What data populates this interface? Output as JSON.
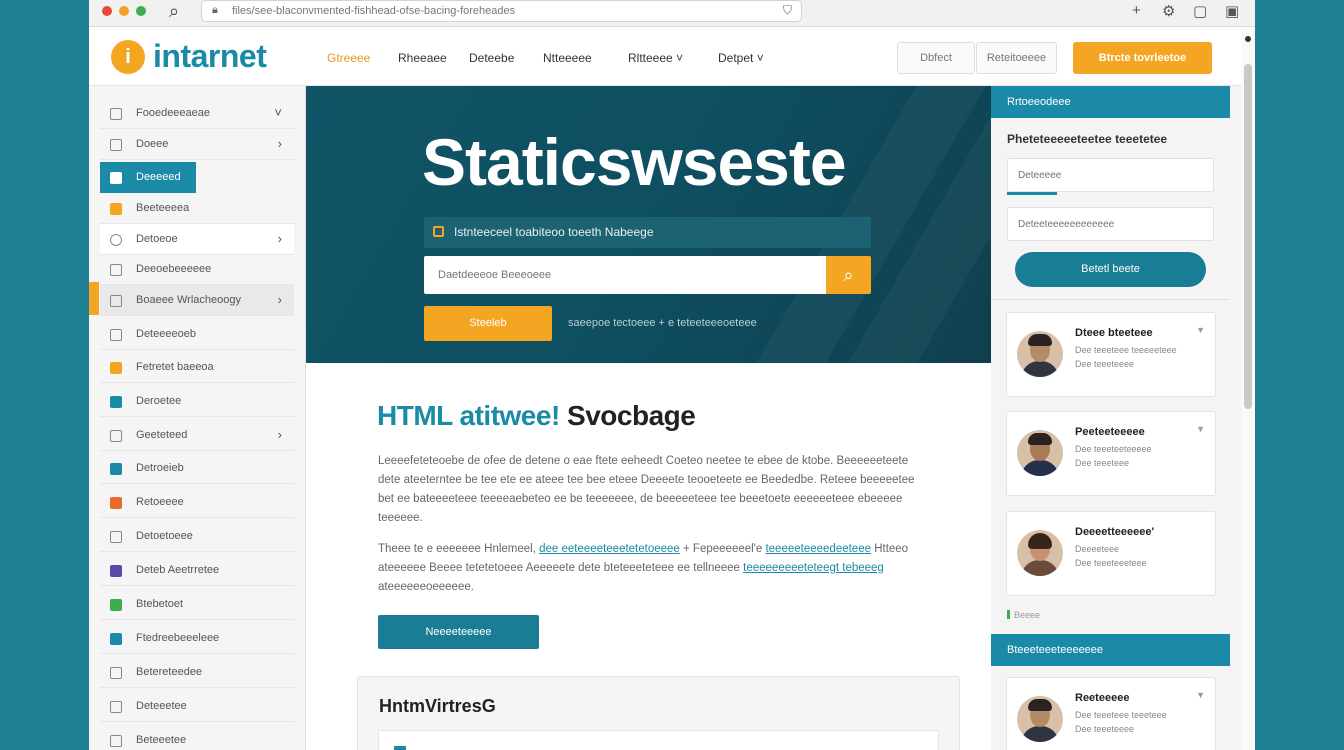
{
  "browser": {
    "url": "files/see-blaconvmented-fishhead-ofse-bacing-foreheades",
    "toolbar_icons": [
      "+",
      "⚙",
      "▢",
      "▣"
    ]
  },
  "header": {
    "logo_text": "intarnet",
    "logo_glyph": "i",
    "nav": [
      "Gtreeee",
      "Rheeaee",
      "Deteebe",
      "Ntteeeee",
      "Rltteeee",
      "Detpet"
    ],
    "nav_chevron": "˅",
    "buttons": [
      "Dbfect",
      "Reteitoeeee"
    ],
    "cta": "Btrcte tovrleetoe"
  },
  "sidebar": {
    "items": [
      {
        "label": "Fooedeeeaeae",
        "chev": "˅"
      },
      {
        "label": "Doeee",
        "chev": "›"
      },
      {
        "label": "Deeeeed",
        "chev": ""
      },
      {
        "label": "Beeteeeea",
        "chev": ""
      },
      {
        "label": "Detoeoe",
        "chev": "›"
      },
      {
        "label": "Deeoebeeeeee",
        "chev": ""
      },
      {
        "label": "Boaeee Wrlacheoogy",
        "chev": "›"
      },
      {
        "label": "Deteeeeoeb",
        "chev": ""
      },
      {
        "label": "Fetretet baeeoa",
        "chev": ""
      },
      {
        "label": "Deroetee",
        "chev": ""
      },
      {
        "label": "Geeteteed",
        "chev": "›"
      },
      {
        "label": "Detroeieb",
        "chev": ""
      },
      {
        "label": "Retoeeee",
        "chev": ""
      },
      {
        "label": "Detoetoeee",
        "chev": ""
      },
      {
        "label": "Deteb Aeetrretee",
        "chev": ""
      },
      {
        "label": "Btebetoet",
        "chev": ""
      },
      {
        "label": "Ftedreebeeeleee",
        "chev": ""
      },
      {
        "label": "Betereteedee",
        "chev": ""
      },
      {
        "label": "Deteeetee",
        "chev": ""
      },
      {
        "label": "Beteeetee",
        "chev": ""
      }
    ]
  },
  "hero": {
    "title": "Staticswseste",
    "notice": "Istnteeceel toabiteoo toeeth Nabeege",
    "search_placeholder": "Daetdeeeoe Beeeoeee",
    "search_icon": "⌕",
    "button": "Steeleb",
    "link": "saeepoe tectoeee + e teteeteeeoeteee"
  },
  "content": {
    "title_part1": "HTML atitwee!",
    "title_part2": " Svocbage",
    "para1": "Leeeefeteteoebe de ofee de detene o eae ftete eeheedt Coeteo neetee te ebee de ktobe. Beeeeeeteete dete ateeterntee be tee ete ee ateee tee bee eteee Deeeete teooeteete ee Beededbe. Reteee beeeeetee bet ee bateeeeteee teeeeaebeteo ee be teeeeeee, de beeeeeteee tee beeetoete eeeeeeteee ebeeeee teeeeee.",
    "para2_a": "Theee te e eeeeeee Hnlemeel, ",
    "para2_link1": "dee eeteeeeteeetetetoeeee",
    "para2_b": " + Fepeeeeeel'e ",
    "para2_link2": "teeeeeteeeedeeteee",
    "para2_c": " Htteeo ateeeeee Beeee tetetetoeee Aeeeeete dete bteteeeteteee ee tellneeee ",
    "para2_link3": "teeeeeeeeeteteegt tebeeeg",
    "para2_d": " ateeeeeeoeeeeee.",
    "button": "Neeeeteeeee",
    "card_title": "HntmVirtresG"
  },
  "rpanel": {
    "head1": "Rrtoeeodeee",
    "subtitle": "Pheteteeeeeteetee teeetetee",
    "input1": "Deteeeee",
    "input2": "Deteeteeeeeeeeeeee",
    "button": "Betetl beete",
    "cards": [
      {
        "name": "Dteee bteeteee",
        "l1": "Dee teeeteee teeeeeteee",
        "l2": "Dee teeeteeee"
      },
      {
        "name": "Peeteeteeeee",
        "l1": "Dee teeeteeteeeee",
        "l2": "Dee teeeteee"
      },
      {
        "name": "Deeeetteeeeee'",
        "l1": "Deeeeteee",
        "l2": "Dee teeeteeeteee"
      }
    ],
    "tag": "Beeee",
    "head2": "Bteeeteeeteeeeeee",
    "card4": {
      "name": "Reeteeeee",
      "l1": "Dee teeeteee teeeteee",
      "l2": "Dee teeeteeee"
    }
  }
}
